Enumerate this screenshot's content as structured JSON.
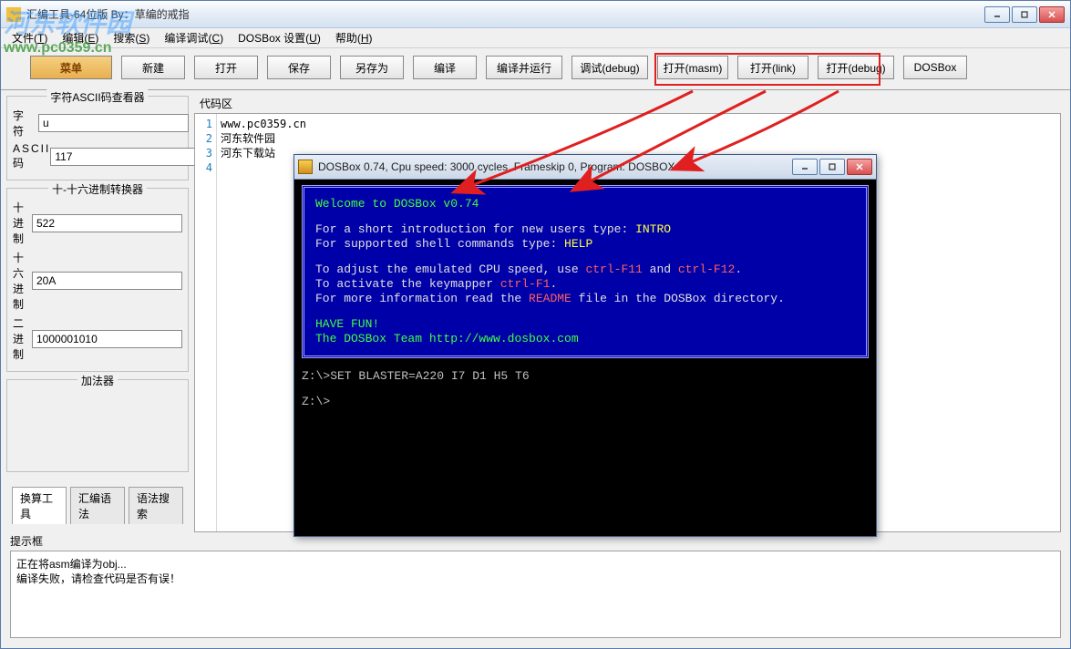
{
  "watermark": {
    "line1": "河东软件园",
    "line2": "www.pc0359.cn"
  },
  "window": {
    "title": "汇编工具-64位版   By：草编的戒指",
    "menus": [
      {
        "label": "文件",
        "accel": "T"
      },
      {
        "label": "编辑",
        "accel": "E"
      },
      {
        "label": "搜索",
        "accel": "S"
      },
      {
        "label": "编译调试",
        "accel": "C"
      },
      {
        "label": "DOSBox 设置",
        "accel": "U"
      },
      {
        "label": "帮助",
        "accel": "H"
      }
    ]
  },
  "toolbar": {
    "menu_btn": "菜单",
    "buttons": [
      "新建",
      "打开",
      "保存",
      "另存为",
      "编译",
      "编译并运行",
      "调试(debug)",
      "打开(masm)",
      "打开(link)",
      "打开(debug)",
      "DOSBox"
    ]
  },
  "left": {
    "ascii": {
      "legend": "字符ASCII码查看器",
      "char_label": "字　符",
      "char_value": "u",
      "code_label": "ASCII码",
      "code_value": "117"
    },
    "radix": {
      "legend": "十-十六进制转换器",
      "dec_label": "十 进 制",
      "dec_value": "522",
      "hex_label": "十六进制",
      "hex_value": "20A",
      "bin_label": "二 进 制",
      "bin_value": "1000001010"
    },
    "adder": {
      "legend": "加法器"
    },
    "tabs": [
      {
        "label": "换算工具",
        "active": true
      },
      {
        "label": "汇编语法",
        "active": false
      },
      {
        "label": "语法搜索",
        "active": false
      }
    ]
  },
  "code": {
    "title": "代码区",
    "lines": [
      "www.pc0359.cn",
      "河东软件园",
      "河东下载站",
      ""
    ]
  },
  "hint": {
    "title": "提示框",
    "lines": [
      "正在将asm编译为obj...",
      "编译失败，请检查代码是否有误！"
    ]
  },
  "dosbox": {
    "title": "DOSBox 0.74, Cpu speed:    3000 cycles, Frameskip  0, Program:    DOSBOX",
    "welcome": "Welcome to DOSBox v0.74",
    "intro1_a": "For a short introduction for new users type: ",
    "intro1_b": "INTRO",
    "intro2_a": "For supported shell commands type: ",
    "intro2_b": "HELP",
    "speed_a": "To adjust the emulated CPU speed, use ",
    "speed_b": "ctrl-F11",
    "speed_c": " and ",
    "speed_d": "ctrl-F12",
    "speed_e": ".",
    "keymap_a": "To activate the keymapper ",
    "keymap_b": "ctrl-F1",
    "keymap_c": ".",
    "readme_a": "For more information read the ",
    "readme_b": "README",
    "readme_c": " file in the DOSBox directory.",
    "fun": "HAVE FUN!",
    "team_a": "The DOSBox Team ",
    "team_b": "http://www.dosbox.com",
    "prompt1": "Z:\\>SET BLASTER=A220 I7 D1 H5 T6",
    "prompt2": "Z:\\>"
  }
}
